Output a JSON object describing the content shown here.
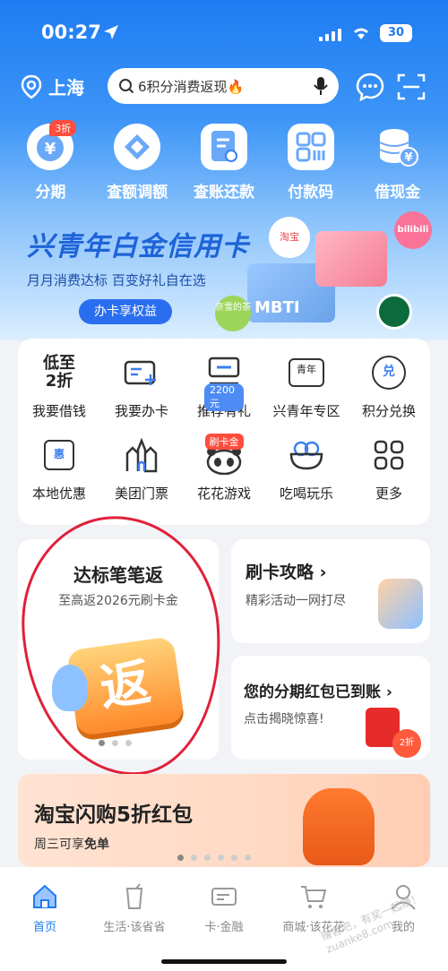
{
  "status": {
    "time": "00:27",
    "battery": "30"
  },
  "topbar": {
    "location": "上海",
    "search_placeholder": "6积分消费返现🔥"
  },
  "quick": [
    {
      "label": "分期",
      "badge": "3折",
      "icon": "installment-bag-icon"
    },
    {
      "label": "查额调额",
      "icon": "quota-search-icon"
    },
    {
      "label": "查账还款",
      "icon": "bill-icon"
    },
    {
      "label": "付款码",
      "icon": "pay-code-icon"
    },
    {
      "label": "借现金",
      "icon": "cash-coins-icon"
    }
  ],
  "banner": {
    "title": "兴青年白金信用卡",
    "subtitle": "月月消费达标  百变好礼自在选",
    "button": "办卡享权益",
    "card_text_1": "MBTI",
    "brand_1": "淘宝",
    "brand_2": "bilibili",
    "brand_3": "奈雪的茶"
  },
  "grid": [
    {
      "label": "我要借钱",
      "icon_text": "低至\n2折",
      "icon": "loan-icon"
    },
    {
      "label": "我要办卡",
      "icon": "add-card-icon"
    },
    {
      "label": "推荐有礼",
      "tag": "2200元",
      "icon": "recommend-gift-icon"
    },
    {
      "label": "兴青年专区",
      "icon_text": "青年",
      "icon": "youth-zone-icon"
    },
    {
      "label": "积分兑换",
      "icon_text": "兑",
      "icon": "points-exchange-icon"
    },
    {
      "label": "本地优惠",
      "icon_text": "惠",
      "icon": "local-deals-icon"
    },
    {
      "label": "美团门票",
      "icon": "castle-ticket-icon"
    },
    {
      "label": "花花游戏",
      "tag": "刷卡金",
      "icon": "panda-game-icon"
    },
    {
      "label": "吃喝玩乐",
      "icon": "food-bowl-icon"
    },
    {
      "label": "更多",
      "icon": "more-grid-icon"
    }
  ],
  "promo_left": {
    "title": "达标笔笔返",
    "subtitle": "至高返2026元刷卡金",
    "art_text": "返"
  },
  "promo_r1": {
    "title": "刷卡攻略",
    "arrow": "›",
    "subtitle": "精彩活动一网打尽"
  },
  "promo_r2": {
    "title": "您的分期红包已到账",
    "arrow": "›",
    "subtitle": "点击揭晓惊喜!",
    "art_text": "2折"
  },
  "taobao": {
    "title": "淘宝闪购5折红包",
    "subtitle_a": "周三可享",
    "subtitle_b": "免单"
  },
  "tabs": [
    {
      "label": "首页",
      "icon": "home-icon",
      "active": true
    },
    {
      "label": "生活·该省省",
      "icon": "drink-icon"
    },
    {
      "label": "卡·金融",
      "icon": "card-icon"
    },
    {
      "label": "商城·该花花",
      "icon": "cart-icon"
    },
    {
      "label": "我的",
      "icon": "profile-icon"
    }
  ],
  "watermark": "赚客吧，有奖一起赚！ zuanke8.com",
  "colors": {
    "primary": "#1d7cf2",
    "red": "#ff4d3d",
    "circle": "#e0203a"
  }
}
